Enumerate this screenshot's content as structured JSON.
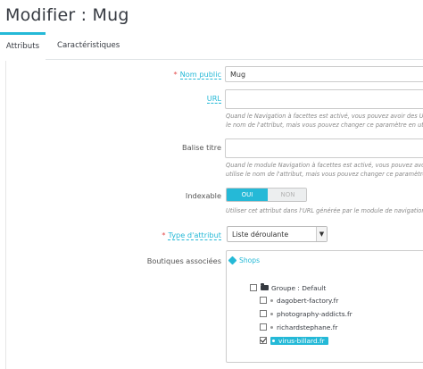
{
  "page": {
    "title": "Modifier : Mug"
  },
  "tabs": [
    {
      "label": "Attributs",
      "active": true
    },
    {
      "label": "Caractéristiques",
      "active": false
    }
  ],
  "form": {
    "nom_public": {
      "label": "Nom public",
      "required": true,
      "value": "Mug"
    },
    "url": {
      "label": "URL",
      "value": "",
      "help": [
        "Quand le Navigation à facettes est activé, vous pouvez avoir des URL plus",
        "le nom de l'attribut, mais vous pouvez changer ce paramètre en utilisant"
      ]
    },
    "balise_titre": {
      "label": "Balise titre",
      "value": "",
      "help": [
        "Quand le module Navigation à facettes est activé, vous pouvez avoir des U",
        "utilise le nom de l'attribut, mais vous pouvez changer ce paramètre en uti"
      ]
    },
    "indexable": {
      "label": "Indexable",
      "on_label": "OUI",
      "off_label": "NON",
      "value": "OUI",
      "help": "Utiliser cet attribut dans l'URL générée par le module de navigation à facettes"
    },
    "type_attribut": {
      "label": "Type d'attribut",
      "required": true,
      "selected": "Liste déroulante"
    },
    "boutiques": {
      "label": "Boutiques associées",
      "header": "Shops",
      "group": {
        "label": "Groupe : Default",
        "checked": false
      },
      "shops": [
        {
          "label": "dagobert-factory.fr",
          "checked": false
        },
        {
          "label": "photography-addicts.fr",
          "checked": false
        },
        {
          "label": "richardstephane.fr",
          "checked": false
        },
        {
          "label": "virus-billard.fr",
          "checked": true
        }
      ]
    }
  },
  "colors": {
    "accent": "#25b9d7",
    "required": "#e34b4b",
    "title": "#363a41"
  }
}
